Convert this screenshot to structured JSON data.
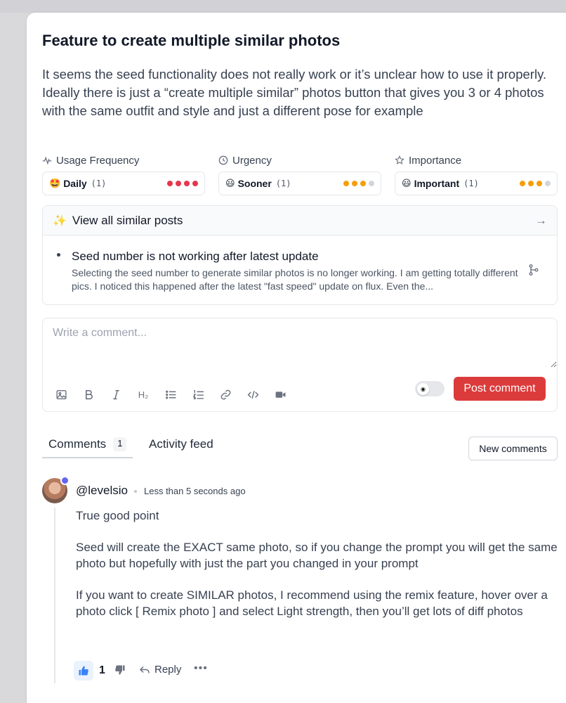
{
  "post": {
    "title": "Feature to create multiple similar photos",
    "description": "It seems the seed functionality does not really work or it’s unclear how to use it properly. Ideally there is just a “create multiple similar” photos button that gives you 3 or 4 photos with the same outfit and style and just a different pose for example"
  },
  "metrics": [
    {
      "label": "Usage Frequency",
      "icon": "activity-icon",
      "emoji": "🤩",
      "value": "Daily",
      "count": "(1)",
      "level": 4,
      "max": 4,
      "color": "#e5364f"
    },
    {
      "label": "Urgency",
      "icon": "clock-icon",
      "emoji": "😃",
      "value": "Sooner",
      "count": "(1)",
      "level": 3,
      "max": 4,
      "color": "#f59e0b"
    },
    {
      "label": "Importance",
      "icon": "star-icon",
      "emoji": "😃",
      "value": "Important",
      "count": "(1)",
      "level": 3,
      "max": 4,
      "color": "#f59e0b"
    }
  ],
  "similar": {
    "header": "View all similar posts",
    "post_title": "Seed number is not working after latest update",
    "post_excerpt": "Selecting the seed number to generate similar photos is no longer working. I am getting totally different pics. I noticed this happened after the latest \"fast speed\" update on flux. Even the..."
  },
  "composer": {
    "placeholder": "Write a comment...",
    "post_label": "Post comment",
    "tools": [
      "image-icon",
      "bold-icon",
      "italic-icon",
      "heading-icon",
      "bullet-list-icon",
      "numbered-list-icon",
      "link-icon",
      "code-icon",
      "video-icon"
    ]
  },
  "tabs": {
    "comments_label": "Comments",
    "comments_count": "1",
    "activity_label": "Activity feed"
  },
  "new_comments_label": "New comments",
  "comment": {
    "author": "@levelsio",
    "time": "Less than 5 seconds ago",
    "paragraphs": [
      "True good point",
      "Seed will create the EXACT same photo, so if you change the prompt you will get the same photo but hopefully with just the part you changed in your prompt",
      "If you want to create SIMILAR photos, I recommend using the remix feature, hover over a photo click [ Remix photo ] and select Light strength, then you’ll get lots of diff photos"
    ],
    "likes": "1",
    "reply_label": "Reply",
    "more_label": "•••"
  }
}
